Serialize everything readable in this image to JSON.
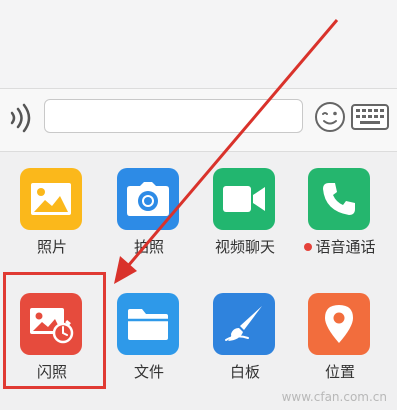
{
  "input_bar": {
    "voice_icon": "voice-wave-icon",
    "message_value": "",
    "emoji_icon": "wink-face-icon",
    "keyboard_icon": "keyboard-icon"
  },
  "apps": [
    {
      "label": "照片",
      "icon": "photo-icon",
      "color": "#fbb81b"
    },
    {
      "label": "拍照",
      "icon": "camera-icon",
      "color": "#2d8be6"
    },
    {
      "label": "视频聊天",
      "icon": "video-camera-icon",
      "color": "#22b66f"
    },
    {
      "label": "语音通话",
      "icon": "phone-icon",
      "color": "#25b66e",
      "badge": "red-dot"
    },
    {
      "label": "闪照",
      "icon": "flash-photo-icon",
      "color": "#e64b3d"
    },
    {
      "label": "文件",
      "icon": "folder-icon",
      "color": "#2e99e9"
    },
    {
      "label": "白板",
      "icon": "whiteboard-brush-icon",
      "color": "#2f83dd"
    },
    {
      "label": "位置",
      "icon": "location-pin-icon",
      "color": "#f26d3d"
    }
  ],
  "annotation": {
    "highlight_color": "#e03a33"
  },
  "watermark": "www.cfan.com.cn"
}
